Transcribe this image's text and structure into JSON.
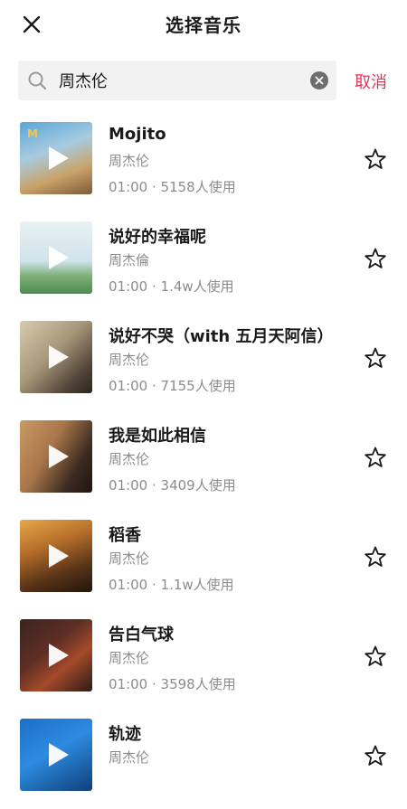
{
  "header": {
    "title": "选择音乐",
    "close_icon": "close-icon"
  },
  "search": {
    "value": "周杰伦",
    "placeholder": "",
    "clear_icon": "clear-icon",
    "cancel_label": "取消"
  },
  "colors": {
    "accent": "#e0345a",
    "secondary_text": "#8c8c8c",
    "search_bg": "#f2f2f2"
  },
  "songs": [
    {
      "title": "Mojito",
      "artist": "周杰伦",
      "meta": "01:00 · 5158人使用"
    },
    {
      "title": "说好的幸福呢",
      "artist": "周杰倫",
      "meta": "01:00 · 1.4w人使用"
    },
    {
      "title": "说好不哭（with 五月天阿信）",
      "artist": "周杰伦",
      "meta": "01:00 · 7155人使用"
    },
    {
      "title": "我是如此相信",
      "artist": "周杰伦",
      "meta": "01:00 · 3409人使用"
    },
    {
      "title": "稻香",
      "artist": "周杰伦",
      "meta": "01:00 · 1.1w人使用"
    },
    {
      "title": "告白气球",
      "artist": "周杰伦",
      "meta": "01:00 · 3598人使用"
    },
    {
      "title": "轨迹",
      "artist": "周杰伦",
      "meta": ""
    }
  ]
}
